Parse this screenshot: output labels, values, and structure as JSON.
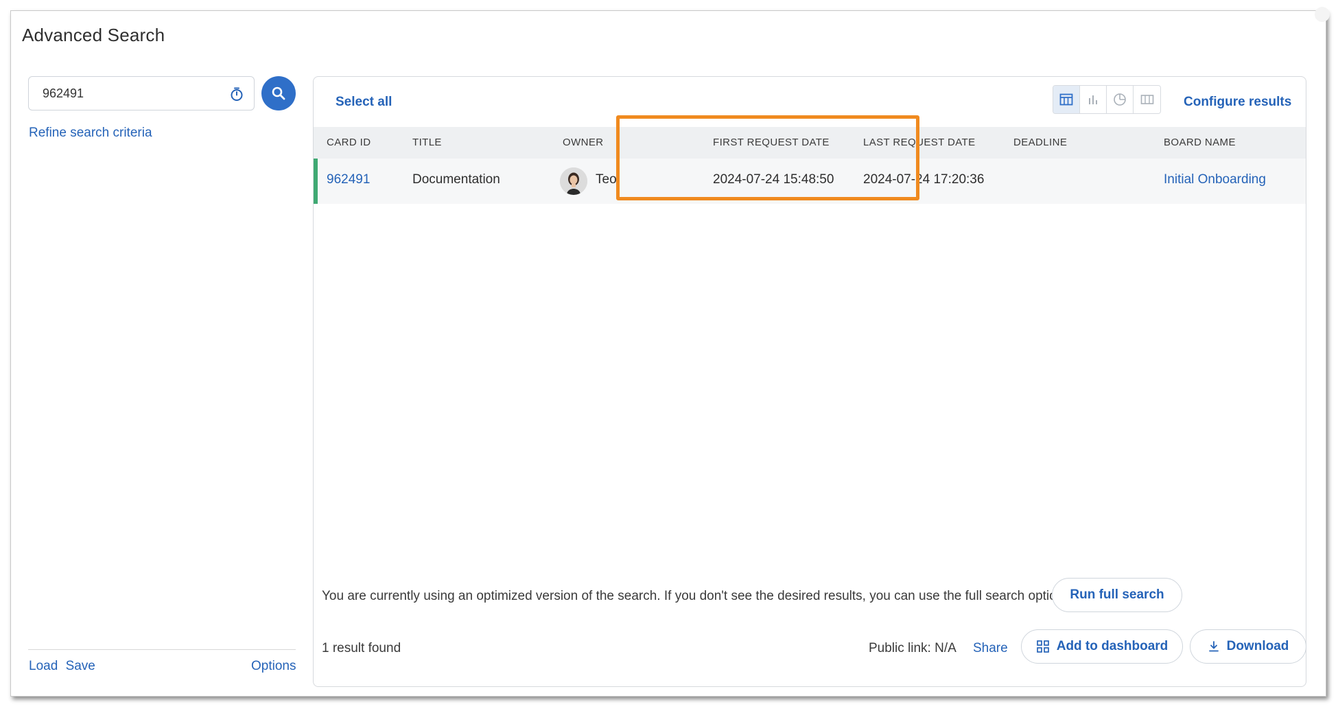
{
  "dialog": {
    "title": "Advanced Search"
  },
  "search": {
    "value": "962491",
    "refine_label": "Refine search criteria"
  },
  "left_footer": {
    "load_label": "Load",
    "save_label": "Save",
    "options_label": "Options"
  },
  "toolbar": {
    "select_all_label": "Select all",
    "configure_label": "Configure results",
    "views": [
      "table-view-icon",
      "bar-chart-icon",
      "pie-chart-icon",
      "columns-view-icon"
    ],
    "active_view": "table-view-icon"
  },
  "table": {
    "columns": [
      "CARD ID",
      "TITLE",
      "OWNER",
      "FIRST REQUEST DATE",
      "LAST REQUEST DATE",
      "DEADLINE",
      "BOARD NAME"
    ],
    "rows": [
      {
        "card_id": "962491",
        "title": "Documentation",
        "owner": "Teo",
        "first_request_date": "2024-07-24 15:48:50",
        "last_request_date": "2024-07-24 17:20:36",
        "deadline": "",
        "board_name": "Initial Onboarding",
        "marker_color": "#3fa973"
      }
    ]
  },
  "notice": {
    "text": "You are currently using an optimized version of the search. If you don't see the desired results, you can use the full search option",
    "run_full_label": "Run full search"
  },
  "footer": {
    "result_count": "1 result found",
    "public_link": "Public link: N/A",
    "share_label": "Share",
    "add_dashboard_label": "Add to dashboard",
    "download_label": "Download"
  },
  "colors": {
    "accent": "#2563b8",
    "highlight": "#f08a1f",
    "search_button": "#2f6fc8"
  }
}
